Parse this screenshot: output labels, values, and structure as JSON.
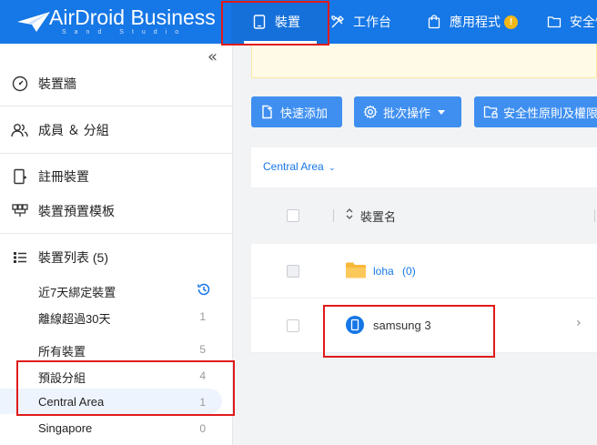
{
  "header": {
    "logo_text": "AirDroid Business",
    "logo_sub": "Sand Studio",
    "nav": [
      {
        "label": "裝置",
        "icon": "tablet-icon",
        "active": true
      },
      {
        "label": "工作台",
        "icon": "tools-icon"
      },
      {
        "label": "應用程式",
        "icon": "shopping-bag-icon",
        "badge": "!"
      },
      {
        "label": "安全性",
        "icon": "folder-icon"
      }
    ]
  },
  "sidebar": {
    "collapse_icon": "double-chevron-left-icon",
    "items": [
      {
        "label": "裝置牆",
        "icon": "dashboard-icon"
      },
      {
        "label": "成員 ＆ 分組",
        "icon": "users-icon"
      },
      {
        "label": "註冊裝置",
        "icon": "enroll-icon"
      },
      {
        "label": "裝置預置模板",
        "icon": "template-icon"
      },
      {
        "label": "裝置列表 (5)",
        "icon": "list-icon"
      }
    ],
    "sub_items": [
      {
        "label": "近7天綁定裝置",
        "count": "",
        "icon": "history-icon"
      },
      {
        "label": "離線超過30天",
        "count": "1"
      },
      {
        "label": "所有裝置",
        "count": "5"
      },
      {
        "label": "預設分組",
        "count": "4"
      },
      {
        "label": "Central Area",
        "count": "1",
        "selected": true
      },
      {
        "label": "Singapore",
        "count": "0"
      }
    ]
  },
  "toolbar": {
    "quick_add": "快速添加",
    "batch_ops": "批次操作",
    "security_policy": "安全性原則及權限"
  },
  "table": {
    "group_filter": "Central Area",
    "column_device_name": "裝置名",
    "rows": [
      {
        "name": "loha",
        "count": "(0)",
        "type": "folder"
      },
      {
        "name": "samsung 3",
        "type": "device"
      }
    ]
  },
  "colors": {
    "brand": "#1677e6",
    "button": "#3f8ff0",
    "highlight": "#e01a1a",
    "folder": "#f7b83a"
  }
}
